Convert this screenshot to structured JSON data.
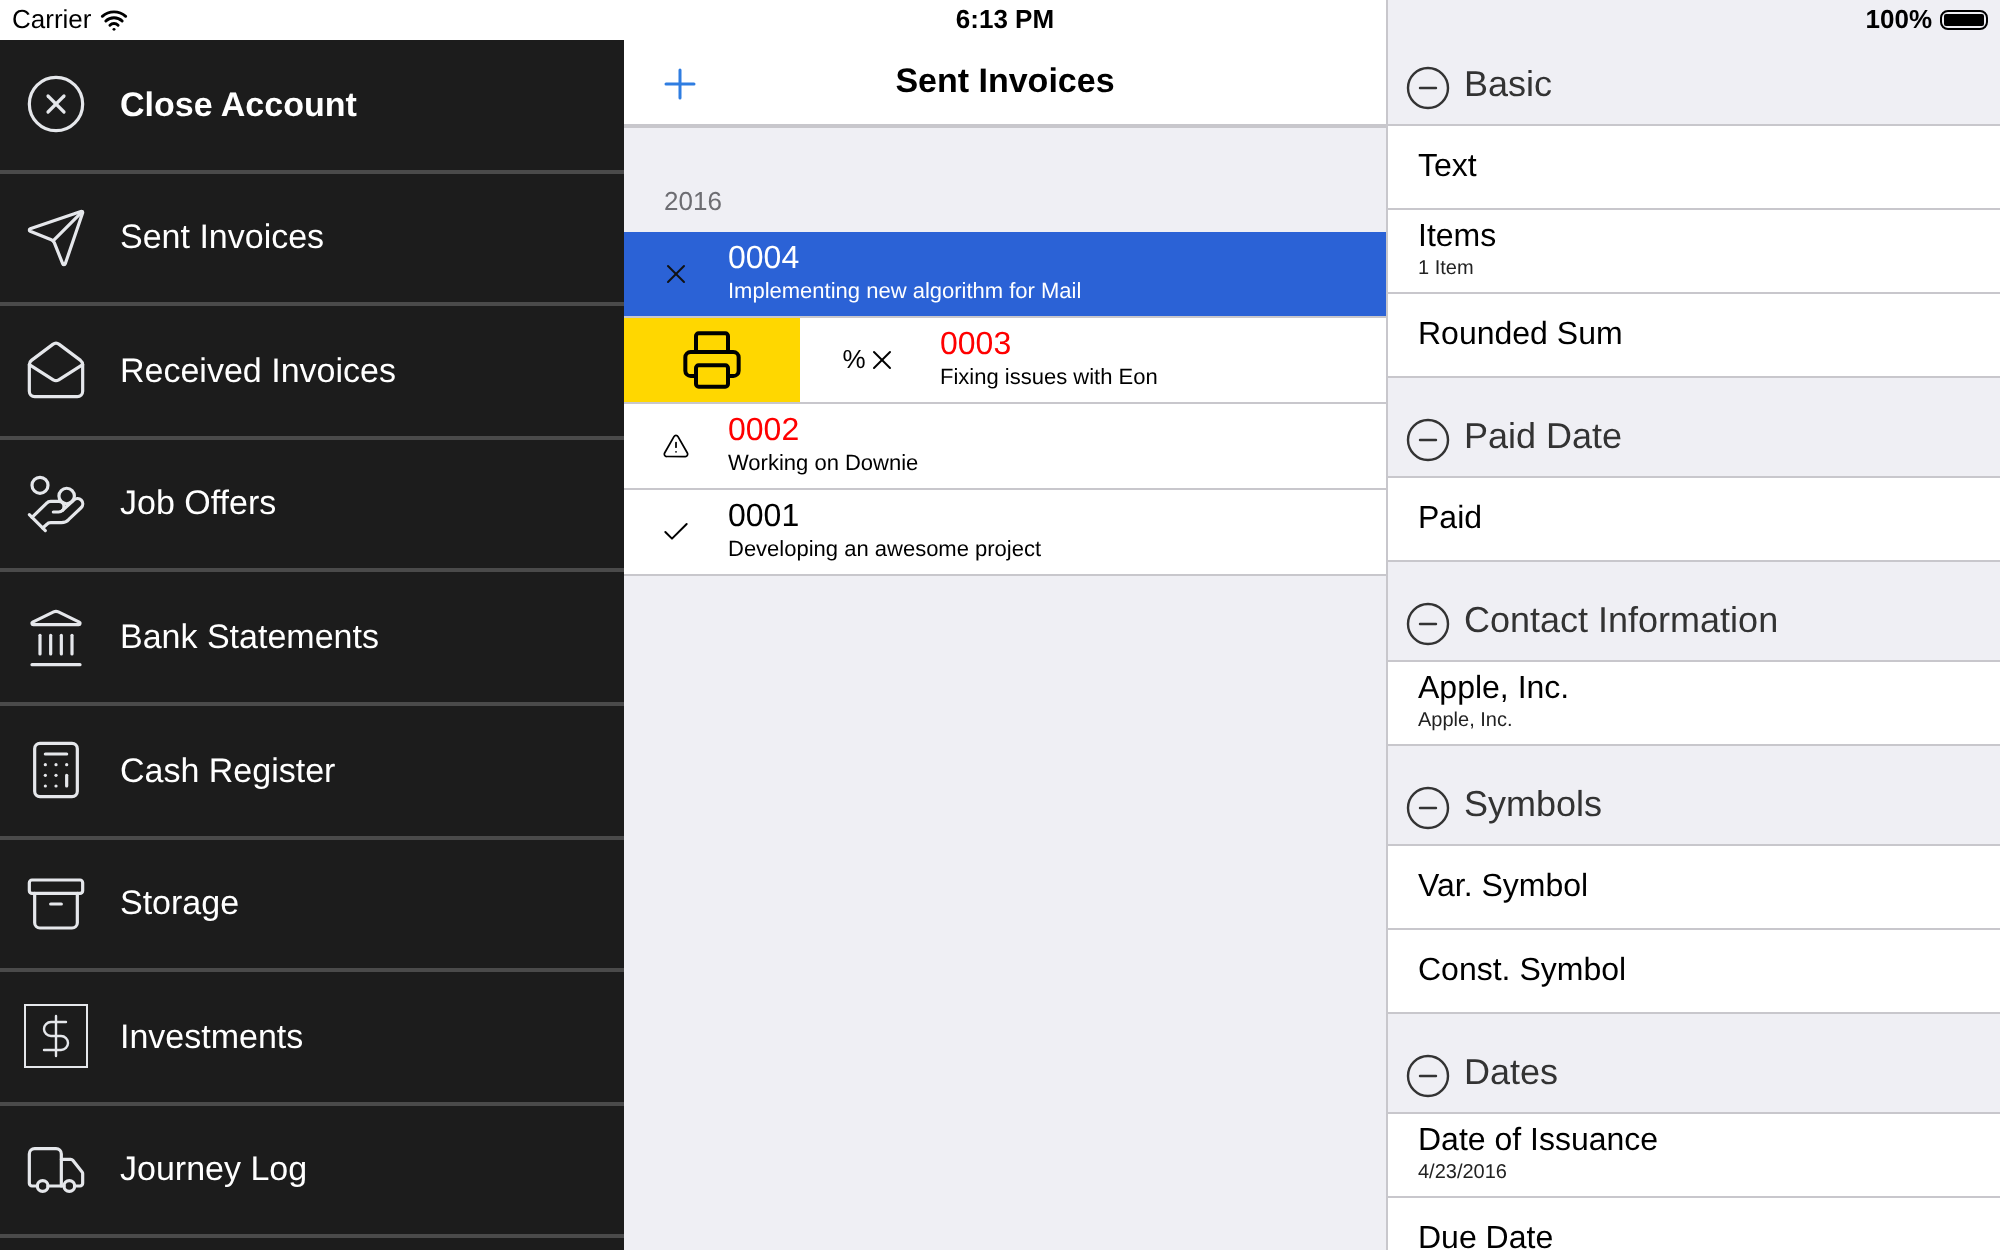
{
  "status_bar": {
    "carrier": "Carrier",
    "time": "6:13 PM",
    "battery": "100%"
  },
  "sidebar": {
    "items": [
      {
        "label": "Close Account",
        "kind": "action"
      },
      {
        "label": "Sent Invoices",
        "kind": "link"
      },
      {
        "label": "Received Invoices",
        "kind": "link"
      },
      {
        "label": "Job Offers",
        "kind": "link"
      },
      {
        "label": "Bank Statements",
        "kind": "link"
      },
      {
        "label": "Cash Register",
        "kind": "link"
      },
      {
        "label": "Storage",
        "kind": "link"
      },
      {
        "label": "Investments",
        "kind": "link"
      },
      {
        "label": "Journey Log",
        "kind": "link"
      }
    ]
  },
  "invoices": {
    "title": "Sent Invoices",
    "section": "2016",
    "rows": [
      {
        "number": "0004",
        "description": "Implementing new algorithm for Mail",
        "kind": "cancelled",
        "overdue": false,
        "selected": true,
        "swiped": false
      },
      {
        "number": "0003",
        "description": "Fixing issues with Eon",
        "kind": "cancelled",
        "prefix": "%",
        "overdue": true,
        "selected": false,
        "swiped": true
      },
      {
        "number": "0002",
        "description": "Working on Downie",
        "kind": "warning",
        "overdue": true,
        "selected": false,
        "swiped": false
      },
      {
        "number": "0001",
        "description": "Developing an awesome project",
        "kind": "paid",
        "overdue": false,
        "selected": false,
        "swiped": false
      }
    ]
  },
  "details": {
    "sections": [
      {
        "title": "Basic",
        "rows": [
          {
            "label": "Text"
          },
          {
            "label": "Items",
            "detail": "1 Item"
          },
          {
            "label": "Rounded Sum"
          }
        ]
      },
      {
        "title": "Paid Date",
        "rows": [
          {
            "label": "Paid"
          }
        ]
      },
      {
        "title": "Contact Information",
        "rows": [
          {
            "label": "Apple, Inc.",
            "detail": "Apple, Inc."
          }
        ]
      },
      {
        "title": "Symbols",
        "rows": [
          {
            "label": "Var. Symbol"
          },
          {
            "label": "Const. Symbol"
          }
        ]
      },
      {
        "title": "Dates",
        "rows": [
          {
            "label": "Date of Issuance",
            "detail": "4/23/2016"
          },
          {
            "label": "Due Date"
          }
        ]
      }
    ]
  }
}
